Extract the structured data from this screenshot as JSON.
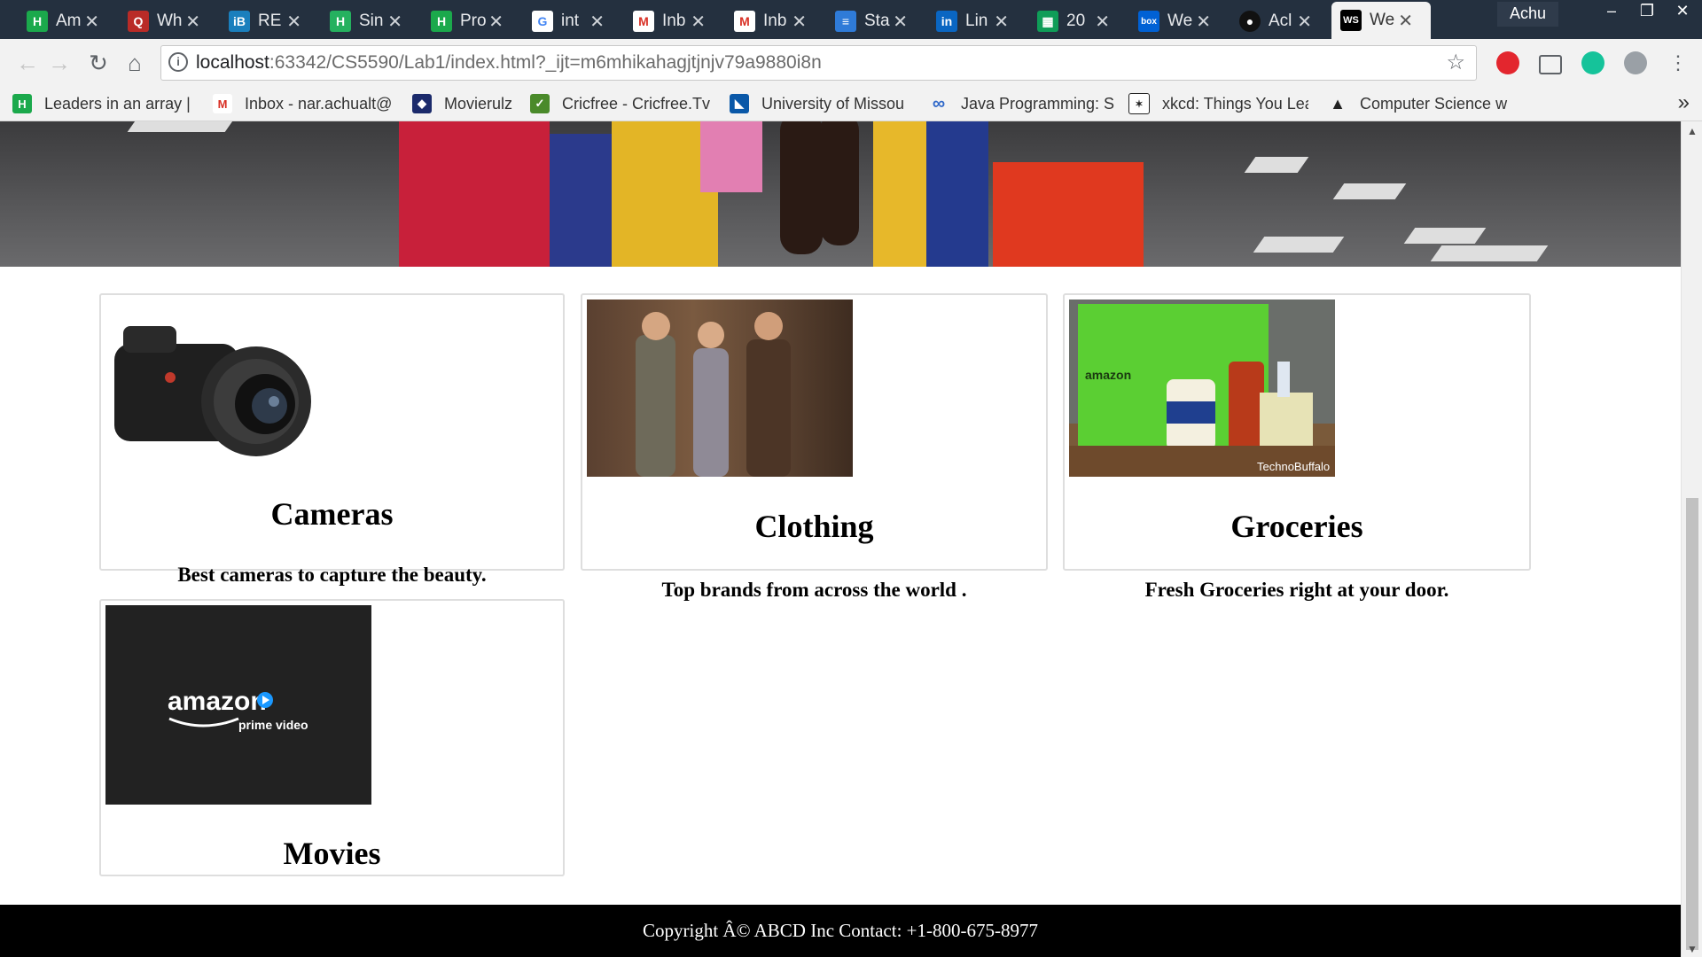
{
  "browser": {
    "tabs": [
      {
        "label": "Am",
        "icon": "hackerrank-icon",
        "color": "#1ba94c"
      },
      {
        "label": "Wh",
        "icon": "quora-icon",
        "color": "#b92b27"
      },
      {
        "label": "RE",
        "icon": "interviewbit-icon",
        "color": "#1a7fbd"
      },
      {
        "label": "Sin",
        "icon": "hackerearth-icon",
        "color": "#25b15f"
      },
      {
        "label": "Pro",
        "icon": "hackerrank-icon",
        "color": "#1ba94c"
      },
      {
        "label": "int",
        "icon": "google-icon",
        "color": "#4285f4"
      },
      {
        "label": "Inb",
        "icon": "gmail-icon",
        "color": "#d93025"
      },
      {
        "label": "Inb",
        "icon": "gmail-icon",
        "color": "#d93025"
      },
      {
        "label": "Sta",
        "icon": "stack-icon",
        "color": "#2f7bd8"
      },
      {
        "label": "Lin",
        "icon": "linkedin-icon",
        "color": "#0a66c2"
      },
      {
        "label": "20",
        "icon": "sheets-icon",
        "color": "#0f9d58"
      },
      {
        "label": "We",
        "icon": "box-icon",
        "color": "#0061d5"
      },
      {
        "label": "Acl",
        "icon": "github-icon",
        "color": "#333333"
      },
      {
        "label": "We",
        "icon": "webstorm-icon",
        "color": "#000000"
      }
    ],
    "active_tab": 13,
    "profile_name": "Achu",
    "url_host": "localhost",
    "url_rest": ":63342/CS5590/Lab1/index.html?_ijt=m6mhikahagjtjnjv79a9880i8n",
    "bookmarks": [
      {
        "label": "Leaders in an array |",
        "icon": "hackerrank-icon",
        "color": "#1ba94c"
      },
      {
        "label": "Inbox - nar.achualt@",
        "icon": "gmail-icon",
        "color": "#d93025"
      },
      {
        "label": "Movierulz",
        "icon": "movierulz-icon",
        "color": "#1b2a6b"
      },
      {
        "label": "Cricfree - Cricfree.Tv",
        "icon": "cricfree-icon",
        "color": "#4a8a2a"
      },
      {
        "label": "University of Missou",
        "icon": "umkc-icon",
        "color": "#0a58a8"
      },
      {
        "label": "Java Programming: S",
        "icon": "infinity-icon",
        "color": "#2f68c9"
      },
      {
        "label": "xkcd: Things You Lea",
        "icon": "xkcd-icon",
        "color": "#222222"
      },
      {
        "label": "Computer Science w",
        "icon": "graduation-cap-icon",
        "color": "#222222"
      }
    ]
  },
  "page": {
    "cards": [
      {
        "title": "Cameras",
        "description": "Best cameras to capture the beauty.",
        "image": "camera-image"
      },
      {
        "title": "Clothing",
        "description": "Top brands from across the world .",
        "image": "clothing-image"
      },
      {
        "title": "Groceries",
        "description": "Fresh Groceries right at your door.",
        "image": "groceries-image"
      },
      {
        "title": "Movies",
        "description": "",
        "image": "prime-video-image"
      }
    ],
    "prime_logo_word": "amazon",
    "prime_logo_sub": "prime video",
    "groceries_watermark": "TechnoBuffalo",
    "groceries_bag_text": "amazon",
    "footer_text": "Copyright Â© ABCD Inc Contact: +1-800-675-8977"
  }
}
